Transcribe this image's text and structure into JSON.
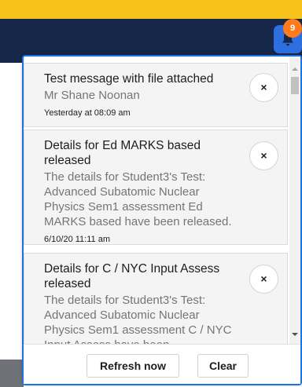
{
  "header": {
    "notification_count": "9",
    "bell_icon": "bell-icon",
    "colors": {
      "accent_bar": "#f6c21b",
      "navbar": "#15284a",
      "bell_button": "#2d6fe0",
      "badge": "#ff7a1a",
      "panel_border": "#1f73e0"
    }
  },
  "notifications": [
    {
      "title": "Test message with file attached",
      "body": "Mr Shane Noonan",
      "time": "Yesterday at 08:09 am",
      "close_label": "×"
    },
    {
      "title": "Details for Ed MARKS based released",
      "body": "The details for Student3's Test: Advanced Subatomic Nuclear Physics Sem1 assessment Ed MARKS based have been released.",
      "time": "6/10/20 11:11 am",
      "close_label": "×"
    },
    {
      "title": "Details for C / NYC Input Assess released",
      "body": "The details for Student3's Test: Advanced Subatomic Nuclear Physics Sem1 assessment C / NYC Input Assess have been",
      "close_label": "×"
    }
  ],
  "footer": {
    "refresh_label": "Refresh now",
    "clear_label": "Clear"
  }
}
